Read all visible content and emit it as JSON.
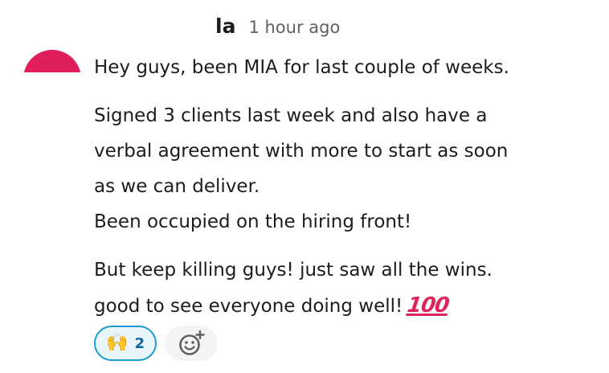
{
  "message": {
    "username": "la",
    "timestamp": "1 hour ago",
    "lines": {
      "p1": "Hey guys, been MIA for last couple of weeks.",
      "p2a": "Signed 3 clients last week and also have a",
      "p2b": "verbal agreement with more to start as soon",
      "p2c": "as we can deliver.",
      "p2d": "Been occupied on the hiring front!",
      "p3a": "But keep killing guys! just saw all the wins.",
      "p3b": "good to see everyone doing well!"
    },
    "inline_emoji": "100"
  },
  "reactions": [
    {
      "emoji_icon": "raised-hands-icon",
      "emoji": "🙌",
      "count": "2",
      "selected": true
    }
  ],
  "add_reaction": {
    "icon": "add-reaction-icon"
  },
  "colors": {
    "avatar": "#e01e5a",
    "reaction_border": "#1d9bd1",
    "reaction_bg": "#e8f5fa",
    "emoji_100": "#e0245e"
  }
}
